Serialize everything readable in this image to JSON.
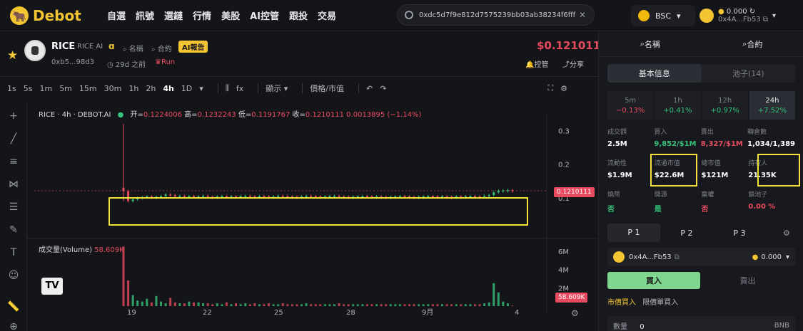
{
  "brand": {
    "name": "Debot"
  },
  "nav": [
    "自選",
    "訊號",
    "選鏈",
    "行情",
    "美股",
    "AI控管",
    "跟投",
    "交易"
  ],
  "search": {
    "value": "0xdc5d7f9e812d7575239bb03ab38234f6fff0",
    "placeholder": ""
  },
  "chain": {
    "label": "BSC"
  },
  "wallet": {
    "balance": "0.000",
    "address": "0x4A...Fb53"
  },
  "token": {
    "symbol": "RICE",
    "name": "RICE AI",
    "tags": [
      "名稱",
      "合約"
    ],
    "ai_report": "AI報告",
    "address": "0xb5...98d3",
    "age": "29d 之前",
    "run": "Run",
    "price": "$0.1210111",
    "control": "控管",
    "share": "分享"
  },
  "toolbar": {
    "timeframes": [
      "1s",
      "5s",
      "1m",
      "5m",
      "15m",
      "30m",
      "1h",
      "2h",
      "4h",
      "1D"
    ],
    "active": "4h",
    "indicator": "fx",
    "display": "顯示",
    "price_toggle": "價格/市值"
  },
  "chart": {
    "legend_title": "RICE · 4h · DEBOT.AI",
    "open_label": "开",
    "open": "0.1224006",
    "high_label": "高",
    "high": "0.1232243",
    "low_label": "低",
    "low": "0.1191767",
    "close_label": "收",
    "close": "0.1210111",
    "change": "0.0013895 (−1.14%)",
    "price_tag": "0.1210111",
    "volume_label": "成交量(Volume)",
    "volume_value": "58.609K",
    "volume_tag": "58.609K",
    "tv": "TV"
  },
  "chart_data": {
    "type": "candlestick",
    "price_axis": [
      "0.3",
      "0.2",
      "0.1"
    ],
    "volume_axis": [
      "6M",
      "4M",
      "2M"
    ],
    "x_labels": [
      "19",
      "22",
      "25",
      "28",
      "9月",
      "4"
    ],
    "close_series": [
      0.12,
      0.09,
      0.095,
      0.1,
      0.102,
      0.104,
      0.1,
      0.103,
      0.105,
      0.11,
      0.108,
      0.104,
      0.106,
      0.103,
      0.105,
      0.102,
      0.104,
      0.106,
      0.103,
      0.102,
      0.104,
      0.105,
      0.103,
      0.104,
      0.102,
      0.105,
      0.106,
      0.104,
      0.103,
      0.105,
      0.104,
      0.103,
      0.104,
      0.106,
      0.105,
      0.104,
      0.103,
      0.102,
      0.104,
      0.106,
      0.105,
      0.104,
      0.103,
      0.104,
      0.105,
      0.106,
      0.104,
      0.103,
      0.102,
      0.103,
      0.104,
      0.105,
      0.104,
      0.103,
      0.104,
      0.103,
      0.102,
      0.103,
      0.104,
      0.105,
      0.104,
      0.103,
      0.102,
      0.103,
      0.104,
      0.105,
      0.104,
      0.103,
      0.104,
      0.103,
      0.102,
      0.104,
      0.103,
      0.104,
      0.105,
      0.104,
      0.103,
      0.106,
      0.108,
      0.116,
      0.121,
      0.122,
      0.123,
      0.121
    ],
    "volume_series": [
      6.5,
      2.8,
      1.2,
      0.6,
      0.5,
      0.8,
      0.4,
      1.1,
      0.5,
      0.3,
      0.9,
      0.4,
      0.3,
      0.3,
      0.5,
      0.4,
      0.4,
      0.3,
      0.3,
      0.2,
      0.3,
      0.2,
      0.4,
      0.2,
      0.3,
      0.2,
      0.3,
      0.2,
      0.3,
      0.2,
      0.2,
      0.3,
      0.2,
      0.2,
      0.3,
      0.2,
      0.2,
      0.2,
      0.2,
      0.3,
      0.2,
      0.2,
      0.2,
      0.2,
      0.2,
      0.2,
      0.3,
      0.2,
      0.2,
      0.2,
      0.2,
      0.2,
      0.2,
      0.2,
      0.2,
      0.2,
      0.2,
      0.2,
      0.2,
      0.2,
      0.2,
      0.2,
      0.2,
      0.2,
      0.2,
      0.2,
      0.2,
      0.2,
      0.2,
      0.2,
      0.2,
      0.2,
      0.2,
      0.2,
      0.2,
      0.2,
      0.2,
      0.3,
      0.4,
      2.5,
      1.5,
      0.5,
      0.3,
      0.06
    ],
    "price_range": [
      0.0,
      0.35
    ],
    "volume_range": [
      0,
      7
    ]
  },
  "right": {
    "tabs": [
      "名稱",
      "合約"
    ],
    "segment": [
      "基本信息",
      "池子(14)"
    ],
    "periods": [
      {
        "label": "5m",
        "change": "−0.13%",
        "color": "red"
      },
      {
        "label": "1h",
        "change": "+0.41%",
        "color": "green"
      },
      {
        "label": "12h",
        "change": "+0.97%",
        "color": "green"
      },
      {
        "label": "24h",
        "change": "+7.52%",
        "color": "green"
      }
    ],
    "row1": [
      {
        "label": "成交額",
        "value": "2.5M"
      },
      {
        "label": "買入",
        "value": "9,852/$1M",
        "color": "green"
      },
      {
        "label": "賣出",
        "value": "8,327/$1M",
        "color": "red"
      },
      {
        "label": "轉倉數",
        "value": "1,034/1,389"
      }
    ],
    "row2": [
      {
        "label": "流動性",
        "value": "$1.9M"
      },
      {
        "label": "流通市值",
        "value": "$22.6M"
      },
      {
        "label": "總市值",
        "value": "$121M"
      },
      {
        "label": "持有人",
        "value": "21.35K"
      }
    ],
    "row3": [
      {
        "label": "燒幣",
        "value": "否",
        "color": "green"
      },
      {
        "label": "開源",
        "value": "是",
        "color": "green"
      },
      {
        "label": "棄權",
        "value": "否",
        "color": "red"
      },
      {
        "label": "鎖池子",
        "value": "0.00 %",
        "color": "red"
      }
    ],
    "presets": [
      "P 1",
      "P 2",
      "P 3"
    ],
    "wallet_address": "0x4A...Fb53",
    "wallet_balance": "0.000",
    "buy": "買入",
    "sell": "賣出",
    "order_types": [
      "市價買入",
      "限價單買入"
    ],
    "amount_label": "數量",
    "amount_value": "0",
    "amount_unit": "BNB"
  }
}
